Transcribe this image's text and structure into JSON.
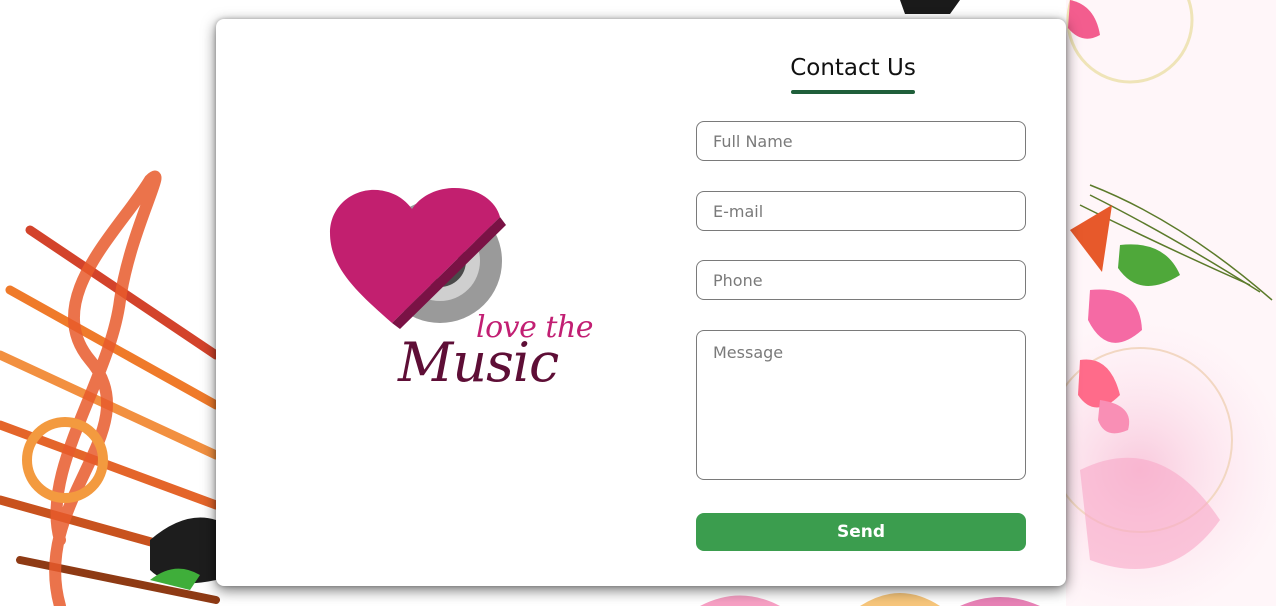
{
  "form": {
    "title": "Contact Us",
    "fields": {
      "full_name": {
        "placeholder": "Full Name",
        "value": ""
      },
      "email": {
        "placeholder": "E-mail",
        "value": ""
      },
      "phone": {
        "placeholder": "Phone",
        "value": ""
      },
      "message": {
        "placeholder": "Message",
        "value": ""
      }
    },
    "submit_label": "Send"
  },
  "logo": {
    "line1": "love the",
    "line2": "Music"
  },
  "colors": {
    "accent_green": "#3b9d4e",
    "underline_green": "#1f5f3a",
    "logo_pink": "#c21f73",
    "logo_plum": "#5e0e36"
  },
  "icons": {
    "background": "music-notes-and-flowers-illustration",
    "logo": "heart-vinyl-record-logo"
  }
}
